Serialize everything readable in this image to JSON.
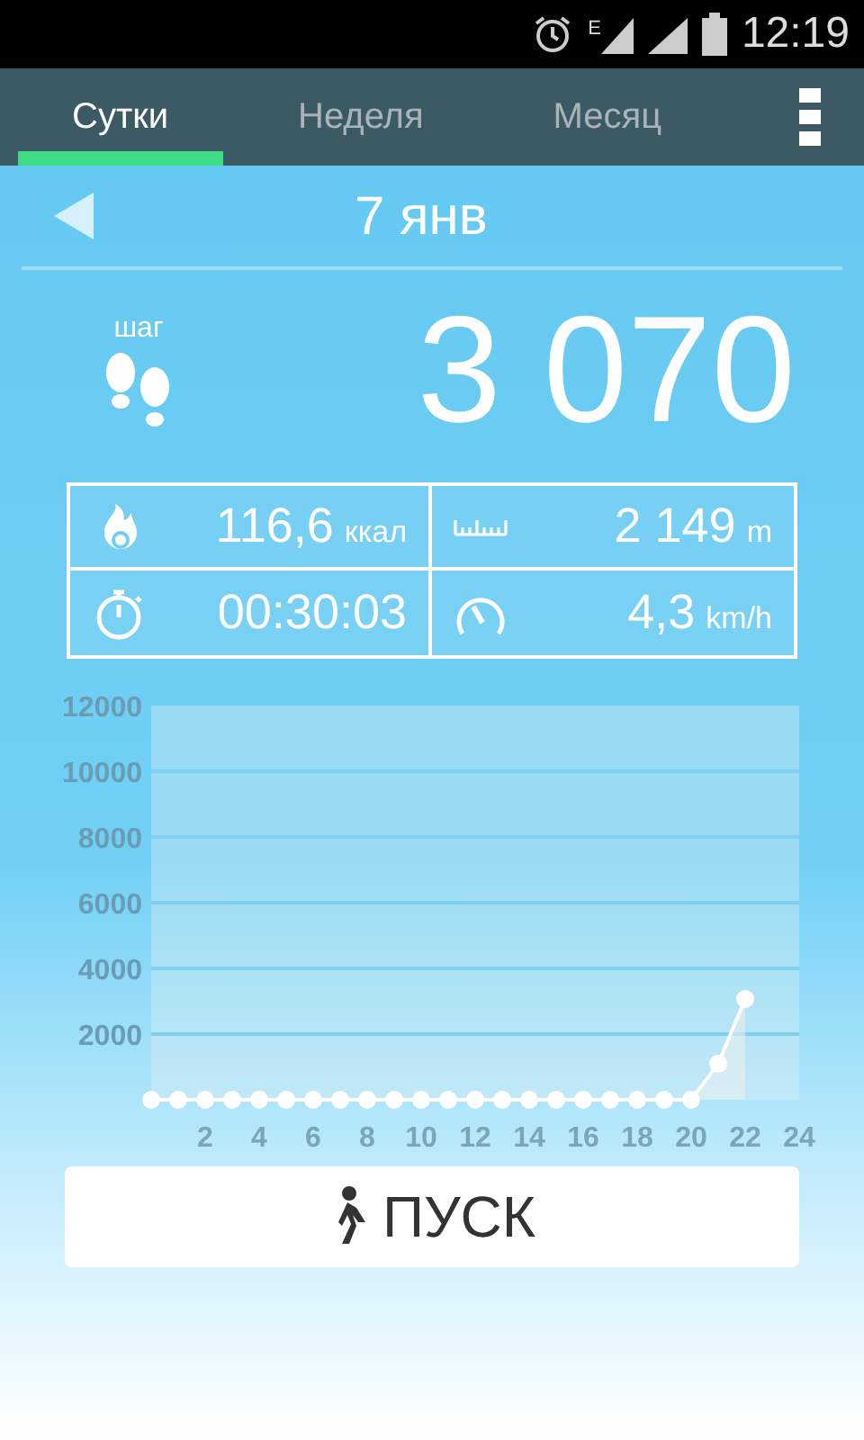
{
  "status_bar": {
    "network": "E",
    "time": "12:19"
  },
  "tabs": [
    {
      "label": "Сутки",
      "selected": true
    },
    {
      "label": "Неделя",
      "selected": false
    },
    {
      "label": "Месяц",
      "selected": false
    }
  ],
  "date": "7 янв",
  "steps": {
    "label": "шаг",
    "value": "3 070"
  },
  "stats": [
    {
      "kind": "calories",
      "value": "116,6",
      "unit": "ккал"
    },
    {
      "kind": "distance",
      "value": "2 149",
      "unit": "m"
    },
    {
      "kind": "time",
      "value": "00:30:03"
    },
    {
      "kind": "speed",
      "value": "4,3",
      "unit": "km/h"
    }
  ],
  "chart_data": {
    "type": "area",
    "x": [
      0,
      1,
      2,
      3,
      4,
      5,
      6,
      7,
      8,
      9,
      10,
      11,
      12,
      13,
      14,
      15,
      16,
      17,
      18,
      19,
      20,
      21,
      22
    ],
    "grid": true,
    "series": [
      {
        "color": "#ffffff",
        "values": [
          0,
          0,
          0,
          0,
          0,
          0,
          0,
          0,
          0,
          0,
          0,
          0,
          0,
          0,
          0,
          0,
          0,
          0,
          0,
          0,
          0,
          1100,
          3070
        ]
      }
    ],
    "xlim": [
      0,
      24
    ],
    "ylim": [
      0,
      12000
    ],
    "xticks": [
      2,
      4,
      6,
      8,
      10,
      12,
      14,
      16,
      18,
      20,
      22,
      24
    ],
    "yticks": [
      2000,
      4000,
      6000,
      8000,
      10000,
      12000
    ]
  },
  "start_button": "ПУСК"
}
